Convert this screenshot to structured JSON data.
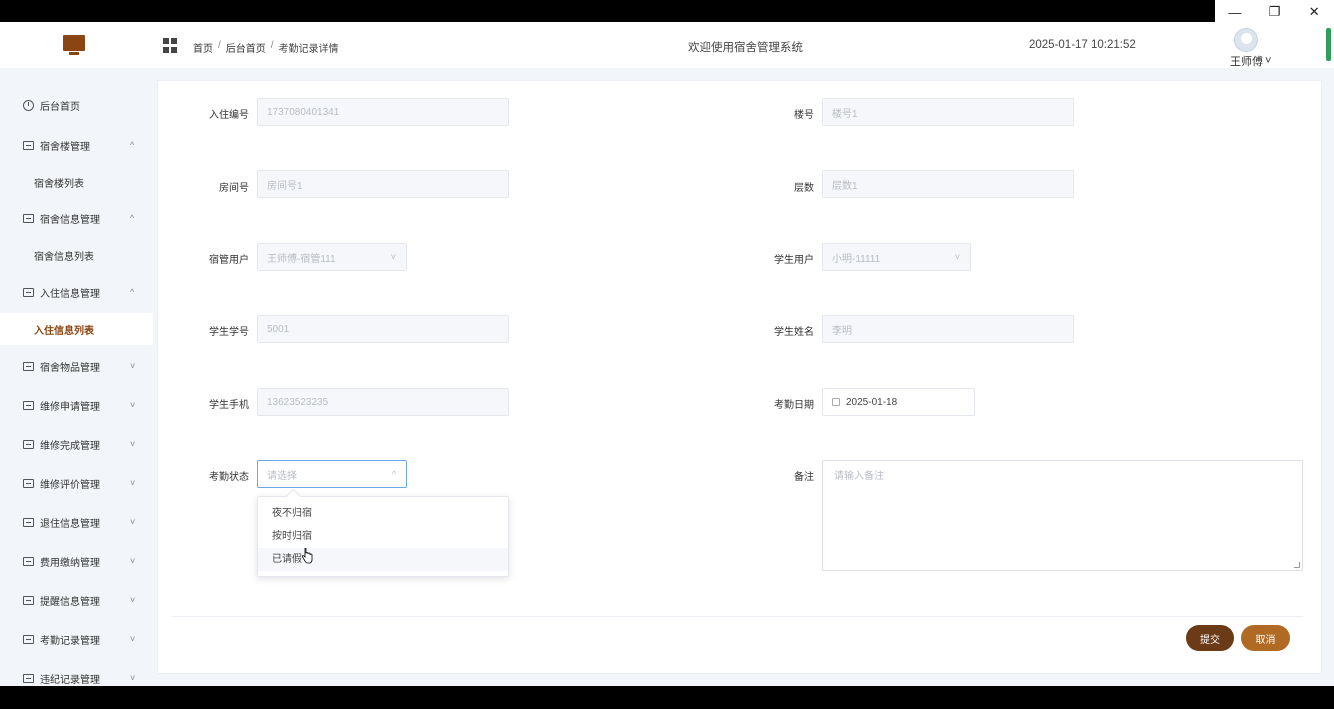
{
  "window": {
    "minimize_glyph": "—",
    "restore_glyph": "❐",
    "close_glyph": "✕"
  },
  "header": {
    "breadcrumb": [
      "首页",
      "后台首页",
      "考勤记录详情"
    ],
    "breadcrumb_separator": "/",
    "welcome": "欢迎使用宿舍管理系统",
    "datetime": "2025-01-17 10:21:52",
    "username": "王师傅",
    "user_caret": "˅"
  },
  "sidebar": {
    "home": "后台首页",
    "menus": [
      {
        "label": "宿舍楼管理",
        "arrow": "^",
        "sub": "宿舍楼列表"
      },
      {
        "label": "宿舍信息管理",
        "arrow": "^",
        "sub": "宿舍信息列表"
      },
      {
        "label": "入住信息管理",
        "arrow": "^",
        "sub": "入住信息列表"
      },
      {
        "label": "宿舍物品管理",
        "arrow": "˅"
      },
      {
        "label": "维修申请管理",
        "arrow": "˅"
      },
      {
        "label": "维修完成管理",
        "arrow": "˅"
      },
      {
        "label": "维修评价管理",
        "arrow": "˅"
      },
      {
        "label": "退住信息管理",
        "arrow": "˅"
      },
      {
        "label": "费用缴纳管理",
        "arrow": "˅"
      },
      {
        "label": "提醒信息管理",
        "arrow": "˅"
      },
      {
        "label": "考勤记录管理",
        "arrow": "˅"
      },
      {
        "label": "违纪记录管理",
        "arrow": "˅"
      }
    ]
  },
  "form": {
    "checkin_no": {
      "label": "入住编号",
      "value": "1737080401341"
    },
    "building_no": {
      "label": "楼号",
      "value": "楼号1"
    },
    "room_no": {
      "label": "房间号",
      "value": "房间号1"
    },
    "floor": {
      "label": "层数",
      "value": "层数1"
    },
    "dorm_user": {
      "label": "宿管用户",
      "value": "王师傅-宿管111"
    },
    "student_user": {
      "label": "学生用户",
      "value": "小明-11111"
    },
    "student_id": {
      "label": "学生学号",
      "value": "5001"
    },
    "student_name": {
      "label": "学生姓名",
      "value": "李明"
    },
    "student_phone": {
      "label": "学生手机",
      "value": "13623523235"
    },
    "attendance_date": {
      "label": "考勤日期",
      "value": "2025-01-18"
    },
    "attendance_status": {
      "label": "考勤状态",
      "placeholder": "请选择"
    },
    "remark": {
      "label": "备注",
      "placeholder": "请输入备注"
    },
    "status_options": [
      "夜不归宿",
      "按时归宿",
      "已请假"
    ],
    "hovered_option_index": 2
  },
  "actions": {
    "submit": "提交",
    "cancel": "取消"
  },
  "colors": {
    "brand": "#8b4513",
    "submit": "#6b3a16",
    "cancel": "#b06a24",
    "focus_border": "#6aa9e9"
  }
}
